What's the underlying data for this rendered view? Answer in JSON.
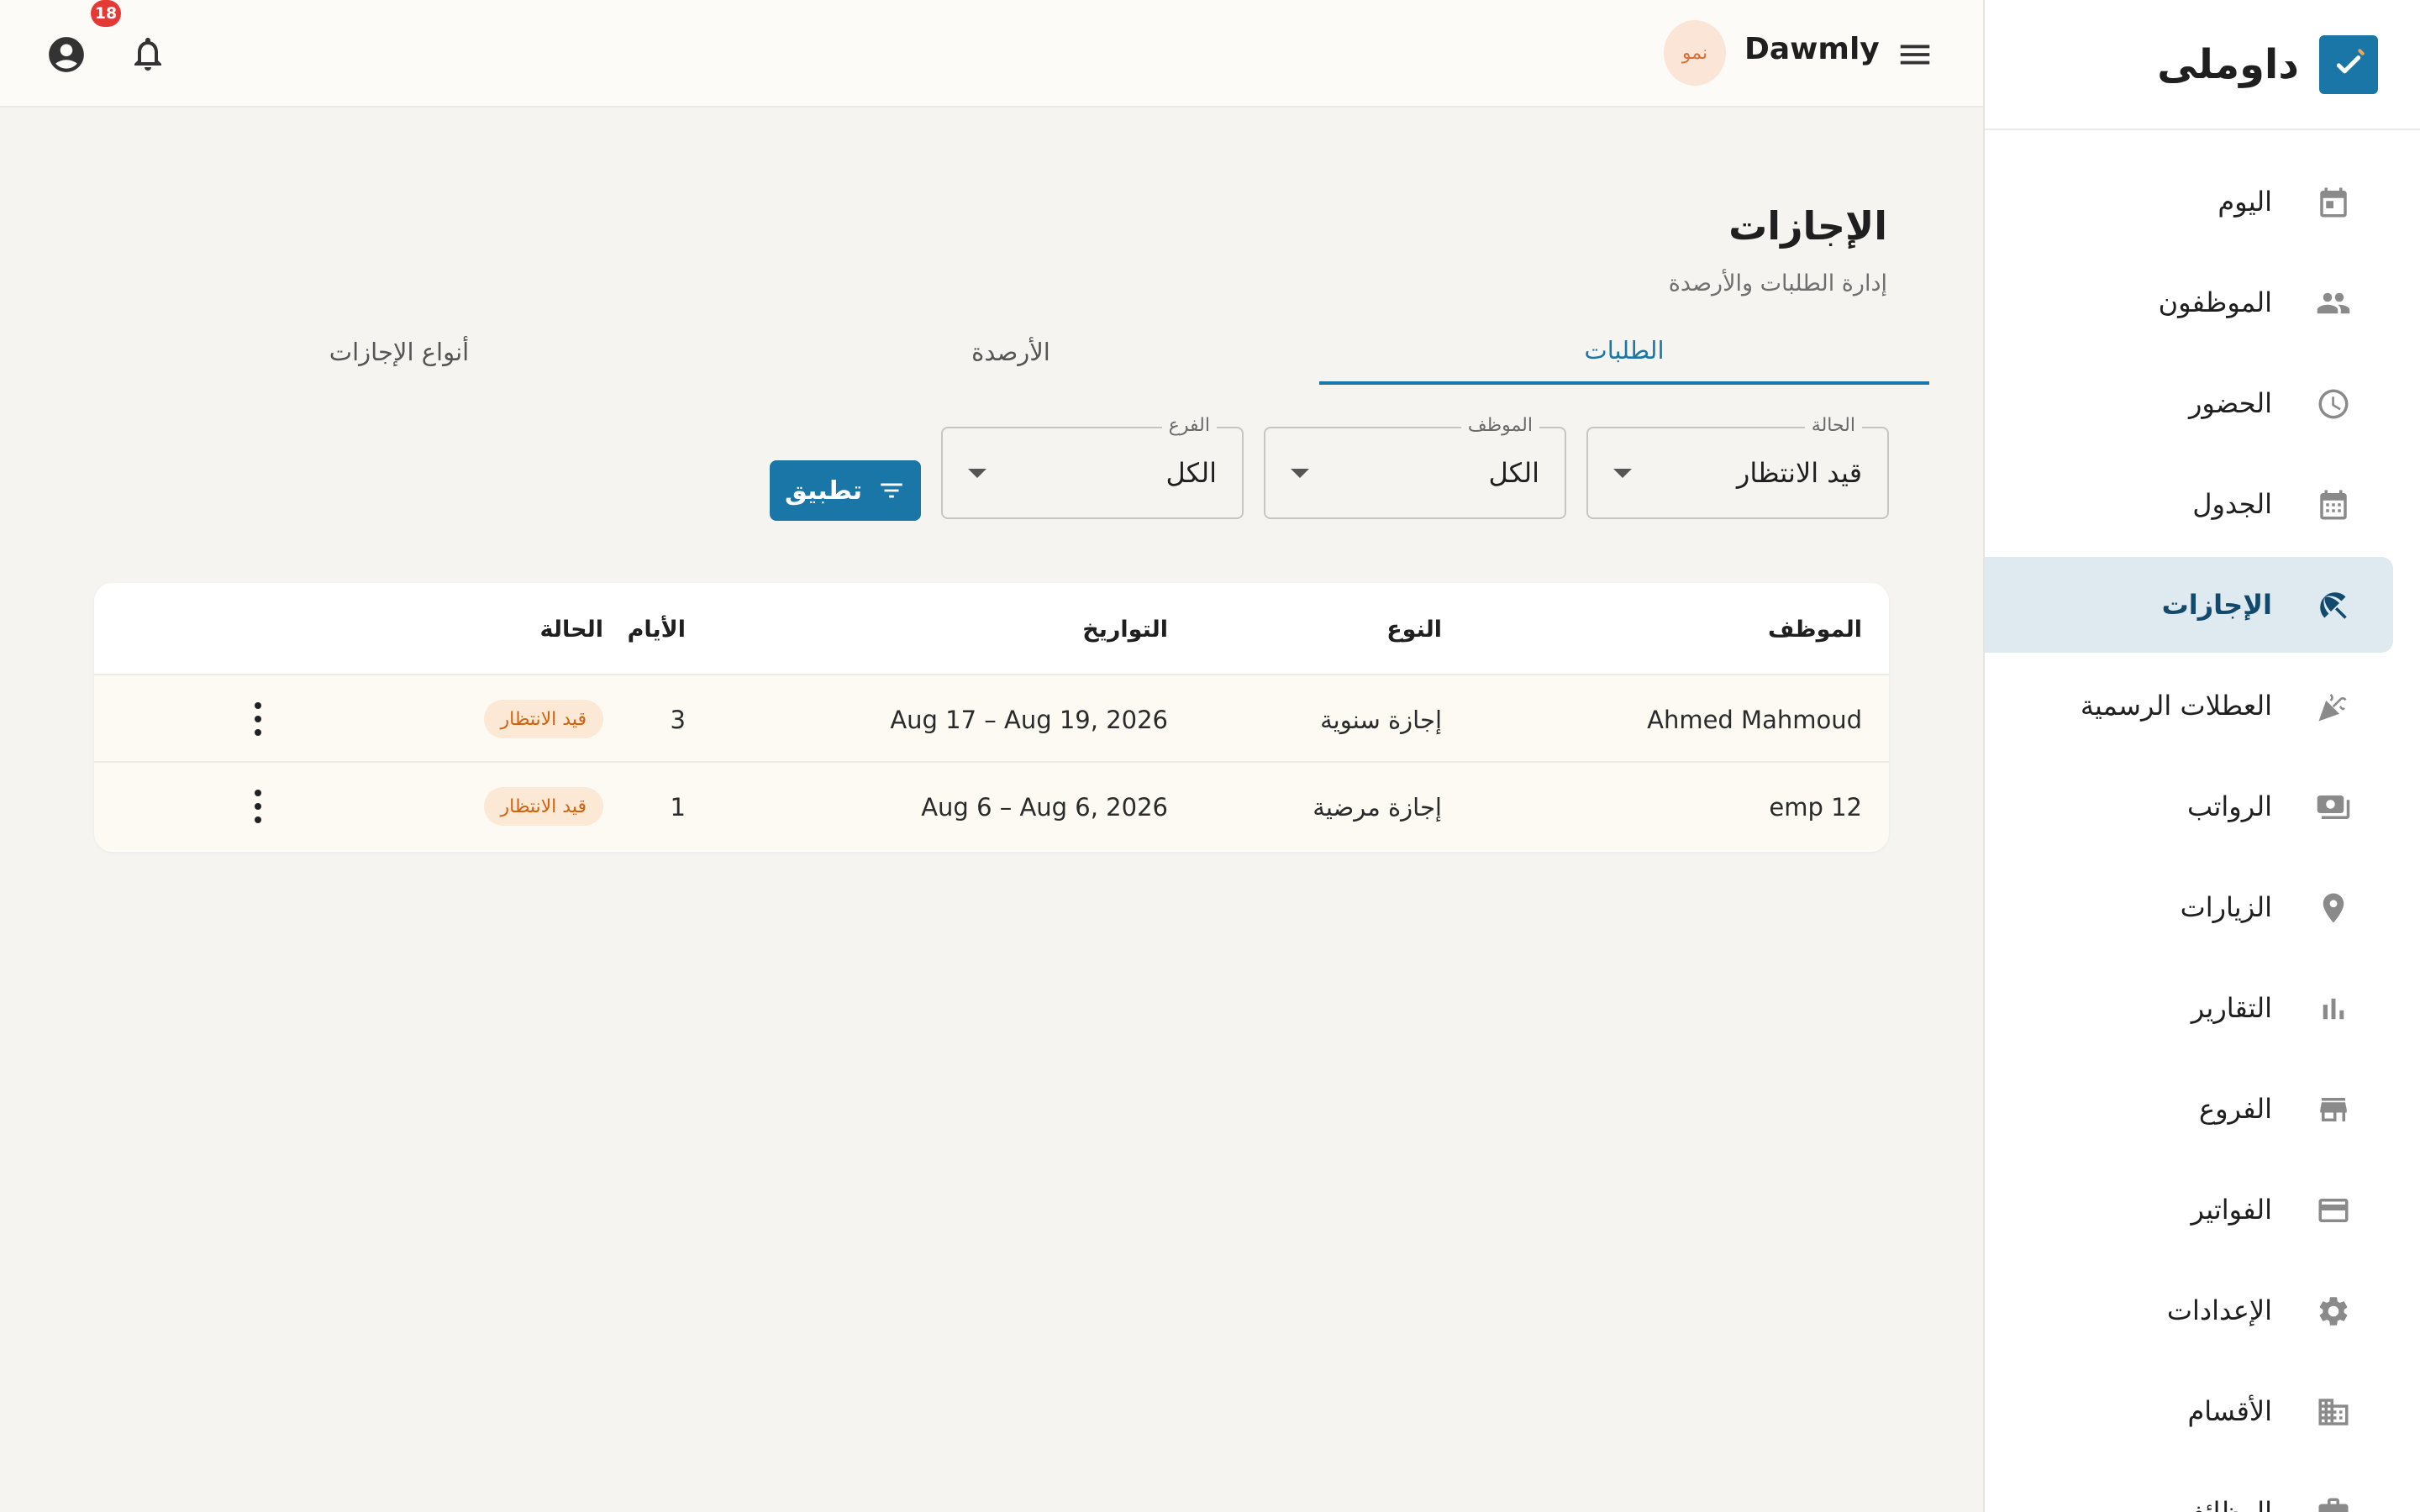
{
  "sidebar": {
    "brand": {
      "name": "داوملى",
      "logo_icon": "check-icon"
    },
    "items": [
      {
        "label": "اليوم",
        "icon": "calendar-today-icon",
        "active": false
      },
      {
        "label": "الموظفون",
        "icon": "people-icon",
        "active": false
      },
      {
        "label": "الحضور",
        "icon": "clock-icon",
        "active": false
      },
      {
        "label": "الجدول",
        "icon": "calendar-grid-icon",
        "active": false
      },
      {
        "label": "الإجازات",
        "icon": "beach-umbrella-icon",
        "active": true
      },
      {
        "label": "العطلات الرسمية",
        "icon": "celebration-icon",
        "active": false
      },
      {
        "label": "الرواتب",
        "icon": "money-icon",
        "active": false
      },
      {
        "label": "الزيارات",
        "icon": "location-pin-icon",
        "active": false
      },
      {
        "label": "التقارير",
        "icon": "bar-chart-icon",
        "active": false
      },
      {
        "label": "الفروع",
        "icon": "store-icon",
        "active": false
      },
      {
        "label": "الفواتير",
        "icon": "credit-card-icon",
        "active": false
      },
      {
        "label": "الإعدادات",
        "icon": "gear-icon",
        "active": false
      },
      {
        "label": "الأقسام",
        "icon": "building-icon",
        "active": false
      },
      {
        "label": "الوظائف",
        "icon": "briefcase-icon",
        "active": false
      }
    ]
  },
  "topbar": {
    "app_name": "Dawmly",
    "avatar_text": "نمو",
    "notification_count": "18"
  },
  "page": {
    "title": "الإجازات",
    "subtitle": "إدارة الطلبات والأرصدة"
  },
  "tabs": [
    {
      "label": "الطلبات",
      "active": true
    },
    {
      "label": "الأرصدة",
      "active": false
    },
    {
      "label": "أنواع الإجازات",
      "active": false
    }
  ],
  "filters": {
    "status": {
      "label": "الحالة",
      "value": "قيد الانتظار"
    },
    "employee": {
      "label": "الموظف",
      "value": "الكل"
    },
    "branch": {
      "label": "الفرع",
      "value": "الكل"
    },
    "apply_label": "تطبيق"
  },
  "table": {
    "columns": {
      "employee": "الموظف",
      "type": "النوع",
      "dates": "التواريخ",
      "days": "الأيام",
      "status": "الحالة"
    },
    "rows": [
      {
        "employee": "Ahmed Mahmoud",
        "type": "إجازة سنوية",
        "dates": "Aug 17 – Aug 19, 2026",
        "days": "3",
        "status": "قيد الانتظار"
      },
      {
        "employee": "emp 12",
        "type": "إجازة مرضية",
        "dates": "Aug 6 – Aug 6, 2026",
        "days": "1",
        "status": "قيد الانتظار"
      }
    ]
  },
  "colors": {
    "accent": "#1b76a8",
    "active_nav_bg": "#dfe9f0",
    "pending_badge_bg": "#fbe8d5",
    "pending_badge_text": "#d1620f",
    "notification_badge": "#e53935"
  }
}
